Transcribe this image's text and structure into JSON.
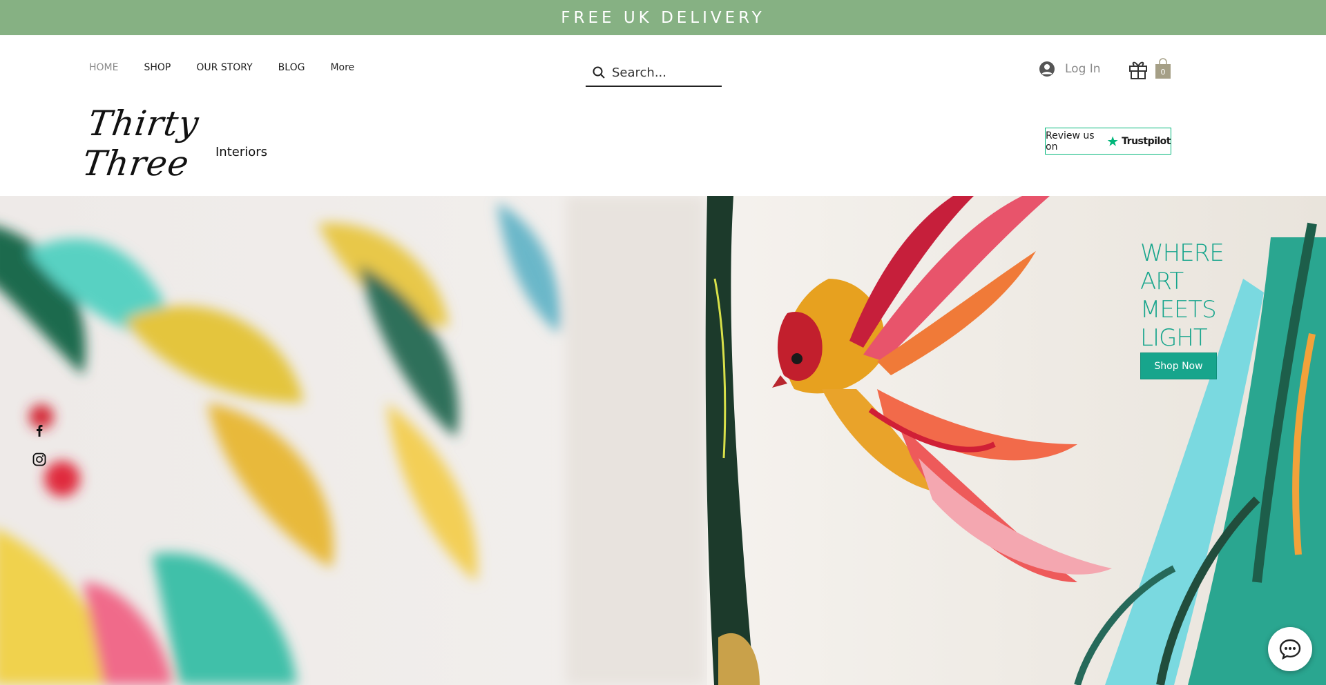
{
  "banner": {
    "text": "FREE UK DELIVERY"
  },
  "nav": {
    "items": [
      {
        "label": "HOME"
      },
      {
        "label": "SHOP"
      },
      {
        "label": "OUR STORY"
      },
      {
        "label": "BLOG"
      },
      {
        "label": "More"
      }
    ]
  },
  "search": {
    "placeholder": "Search..."
  },
  "account": {
    "login_label": "Log In"
  },
  "cart": {
    "count": "0"
  },
  "logo": {
    "script": "Thirty Three",
    "sub": "Interiors"
  },
  "trustpilot": {
    "prefix": "Review us on",
    "brand": "Trustpilot"
  },
  "hero": {
    "tagline": [
      "WHERE",
      "ART",
      "MEETS",
      "LIGHT"
    ],
    "cta_label": "Shop Now"
  },
  "colors": {
    "banner": "#86b183",
    "accent": "#17a58c",
    "trustpilot_green": "#00b67a"
  },
  "icons": [
    "search-icon",
    "user-avatar-icon",
    "gift-icon",
    "shopping-bag-icon",
    "trustpilot-star-icon",
    "facebook-icon",
    "instagram-icon",
    "chat-icon"
  ]
}
